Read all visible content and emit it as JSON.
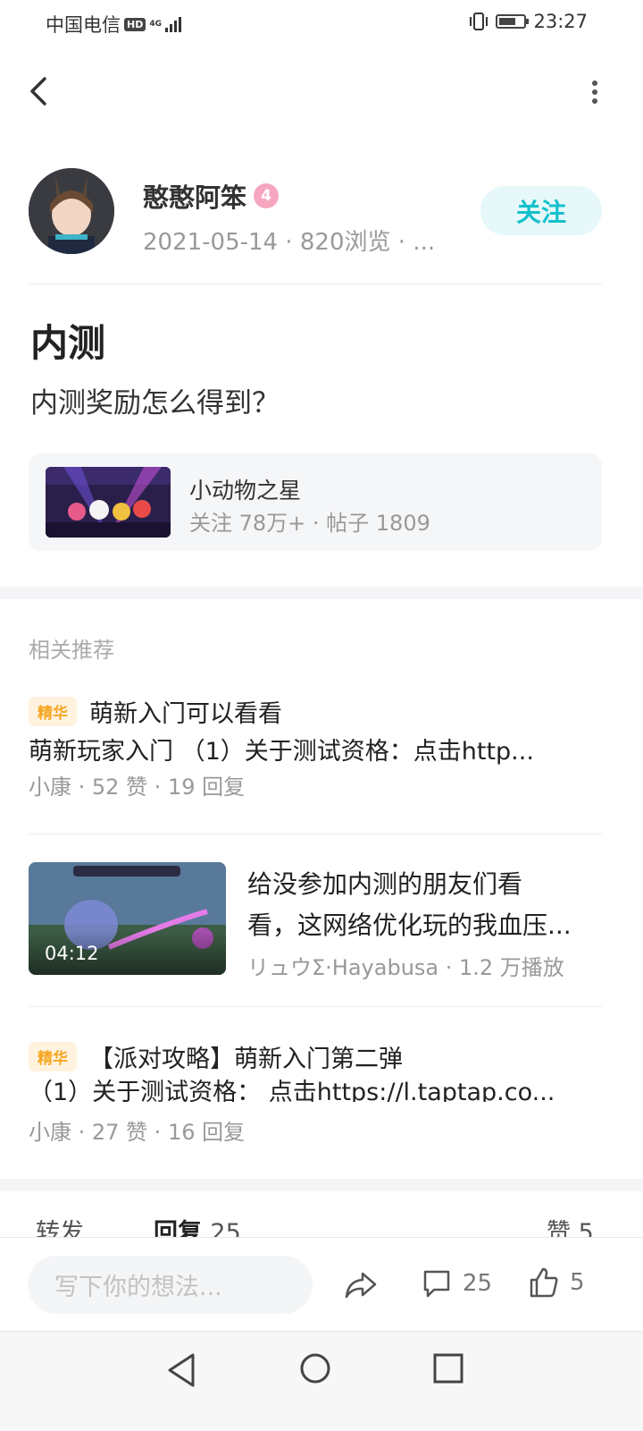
{
  "status_bar": {
    "carrier": "中国电信",
    "hd_badge": "HD",
    "network": "4G",
    "time": "23:27"
  },
  "header": {
    "back_icon": "chevron-left-icon",
    "more_icon": "more-vertical-icon"
  },
  "author": {
    "name": "憨憨阿笨",
    "level": "4",
    "meta": "2021-05-14 · 820浏览 · ...",
    "follow_label": "关注"
  },
  "post": {
    "title": "内测",
    "body": "内测奖励怎么得到？"
  },
  "group": {
    "name": "小动物之星",
    "stats": "关注 78万+ · 帖子 1809"
  },
  "related": {
    "heading": "相关推荐",
    "items": [
      {
        "tag": "精华",
        "title": "萌新入门可以看看",
        "excerpt": "萌新玩家入门 （1）关于测试资格：点击http...",
        "meta": "小康 · 52 赞 · 19 回复"
      },
      {
        "type": "video",
        "duration": "04:12",
        "title_line1": "给没参加内测的朋友们看",
        "title_line2": "看，这网络优化玩的我血压...",
        "meta": "リュウΣ·Hayabusa · 1.2 万播放"
      },
      {
        "tag": "精华",
        "title": "【派对攻略】萌新入门第二弹",
        "excerpt": "（1）关于测试资格： 点击https://l.taptap.co...",
        "meta": "小康 · 27 赞 · 16 回复"
      }
    ]
  },
  "tabs": {
    "forward": "转发",
    "reply": "回复",
    "reply_count": "25",
    "like": "赞",
    "like_count": "5"
  },
  "bottom_bar": {
    "input_placeholder": "写下你的想法...",
    "comment_count": "25",
    "like_count": "5"
  },
  "colors": {
    "accent": "#14c0cb",
    "follow_bg": "#e6f8f9",
    "tag_text": "#f6a623",
    "tag_bg": "#fff3df",
    "level_badge": "#f7a6bf"
  }
}
